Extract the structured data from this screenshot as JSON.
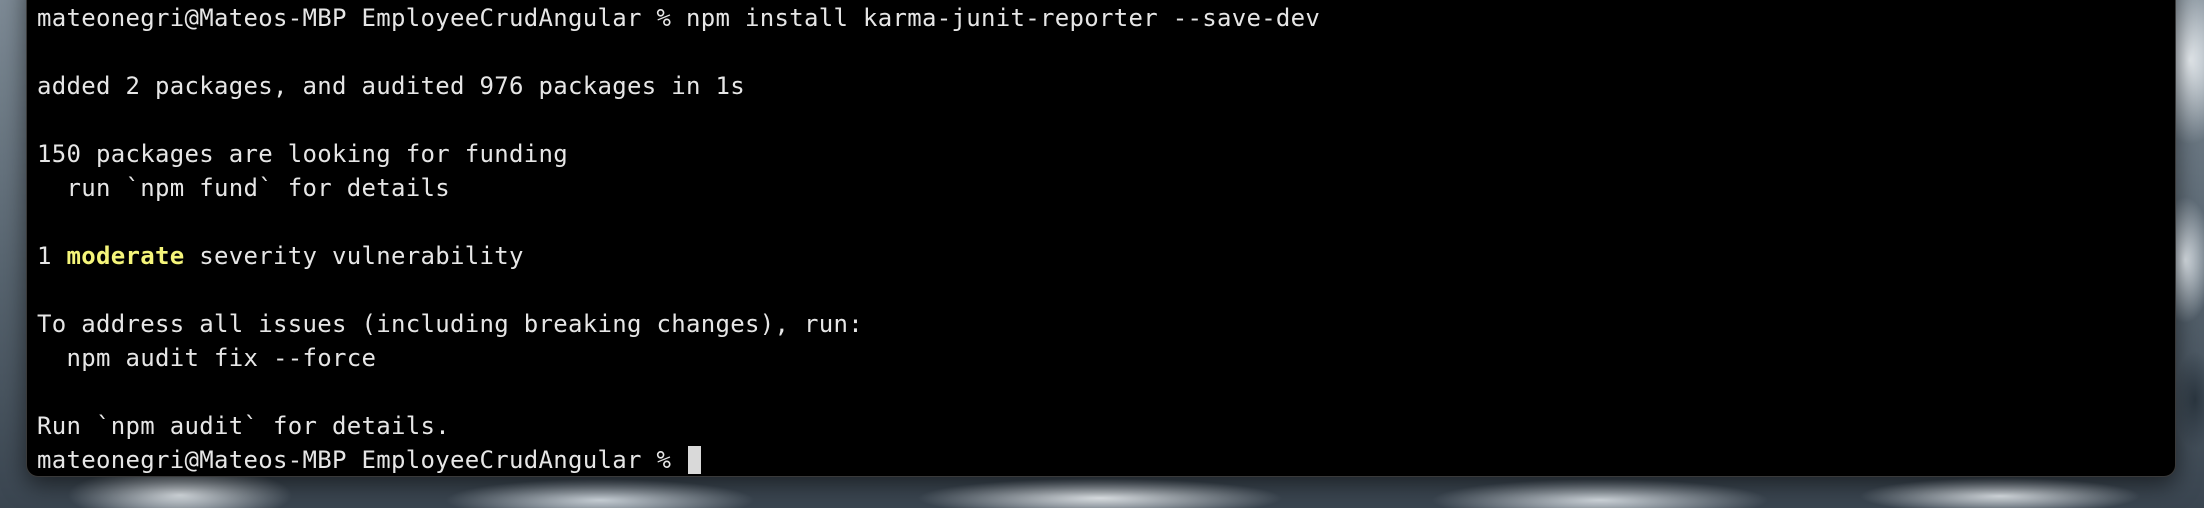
{
  "terminal": {
    "prompt": "mateonegri@Mateos-MBP EmployeeCrudAngular % ",
    "command": "npm install karma-junit-reporter --save-dev",
    "output": {
      "added": "added 2 packages, and audited 976 packages in 1s",
      "funding_line1": "150 packages are looking for funding",
      "funding_line2": "  run `npm fund` for details",
      "vuln_prefix": "1 ",
      "vuln_level": "moderate",
      "vuln_suffix": " severity vulnerability",
      "address_line1": "To address all issues (including breaking changes), run:",
      "address_line2": "  npm audit fix --force",
      "audit_line": "Run `npm audit` for details."
    },
    "colors": {
      "background": "#000000",
      "text": "#e6e6e6",
      "moderate": "#f5f57a"
    }
  }
}
